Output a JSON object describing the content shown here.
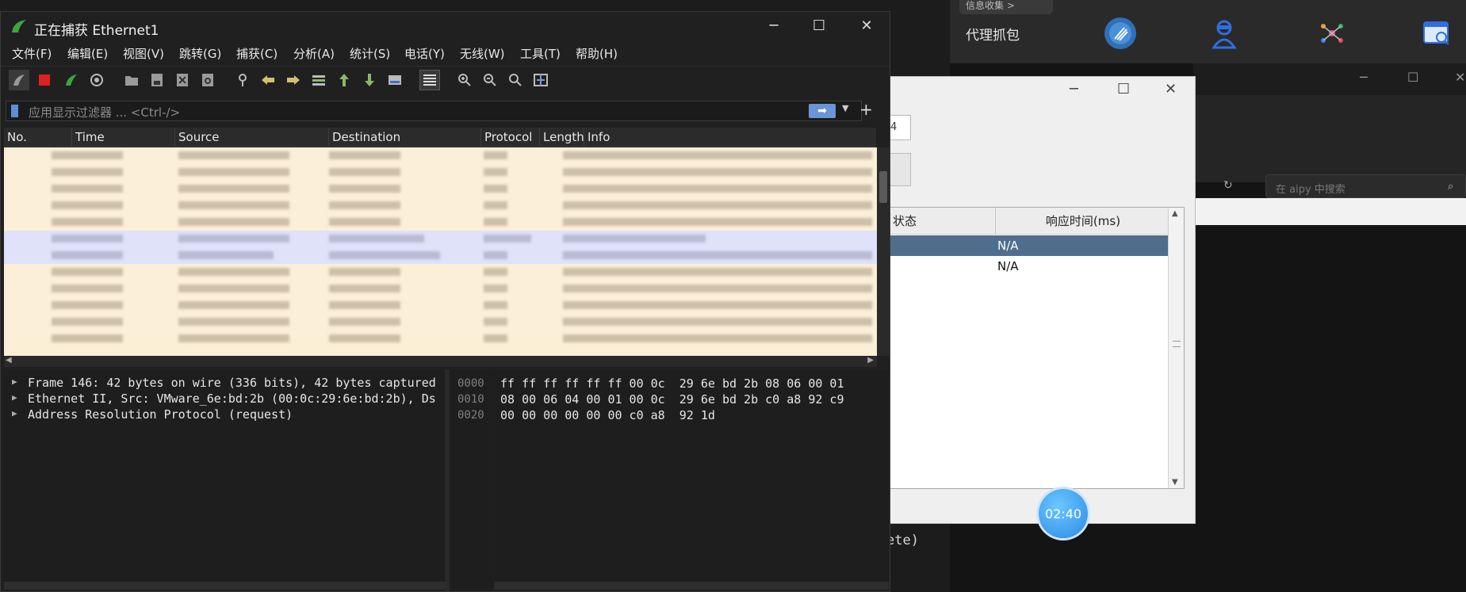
{
  "background": {
    "chip_label": "信息收集 >",
    "proxy_label": "代理抓包",
    "search_placeholder": "在 aipy 中搜索",
    "console_text": "ete)"
  },
  "dialog": {
    "input_value": "4",
    "columns": [
      "状态",
      "响应时间(ms)"
    ],
    "rows": [
      {
        "status": "",
        "time": "N/A",
        "selected": true
      },
      {
        "status": "",
        "time": "N/A",
        "selected": false
      }
    ],
    "timer": "02:40"
  },
  "wireshark": {
    "title": "正在捕获 Ethernet1",
    "menu": [
      "文件(F)",
      "编辑(E)",
      "视图(V)",
      "跳转(G)",
      "捕获(C)",
      "分析(A)",
      "统计(S)",
      "电话(Y)",
      "无线(W)",
      "工具(T)",
      "帮助(H)"
    ],
    "filter_placeholder": "应用显示过滤器 ... <Ctrl-/>",
    "filter_add": "+",
    "columns": [
      "No.",
      "Time",
      "Source",
      "Destination",
      "Protocol",
      "Length",
      "Info"
    ],
    "details": [
      "Frame 146: 42 bytes on wire (336 bits), 42 bytes captured",
      "Ethernet II, Src: VMware_6e:bd:2b (00:0c:29:6e:bd:2b), Ds",
      "Address Resolution Protocol (request)"
    ],
    "hex_offsets": [
      "0000",
      "0010",
      "0020"
    ],
    "hex_lines": [
      "ff ff ff ff ff ff 00 0c  29 6e bd 2b 08 06 00 01",
      "08 00 06 04 00 01 00 0c  29 6e bd 2b c0 a8 92 c9",
      "00 00 00 00 00 00 c0 a8  92 1d"
    ]
  }
}
